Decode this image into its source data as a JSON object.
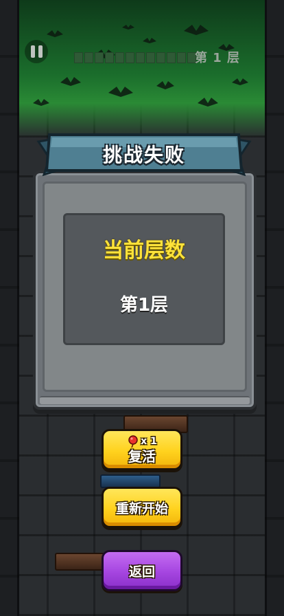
{
  "hud": {
    "floor_label": "第 1 层",
    "progress_segments": 12
  },
  "dialog": {
    "title": "挑战失败",
    "current_floor_label": "当前层数",
    "current_floor_value": "第1层"
  },
  "buttons": {
    "revive_count": "x 1",
    "revive_label": "复活",
    "restart_label": "重新开始",
    "back_label": "返回"
  },
  "colors": {
    "title_yellow": "#ffe33a",
    "button_yellow": "#ffd21e",
    "button_purple": "#a545e0",
    "ribbon_blue": "#4f7f92",
    "dungeon_green": "#1b6e2c"
  }
}
